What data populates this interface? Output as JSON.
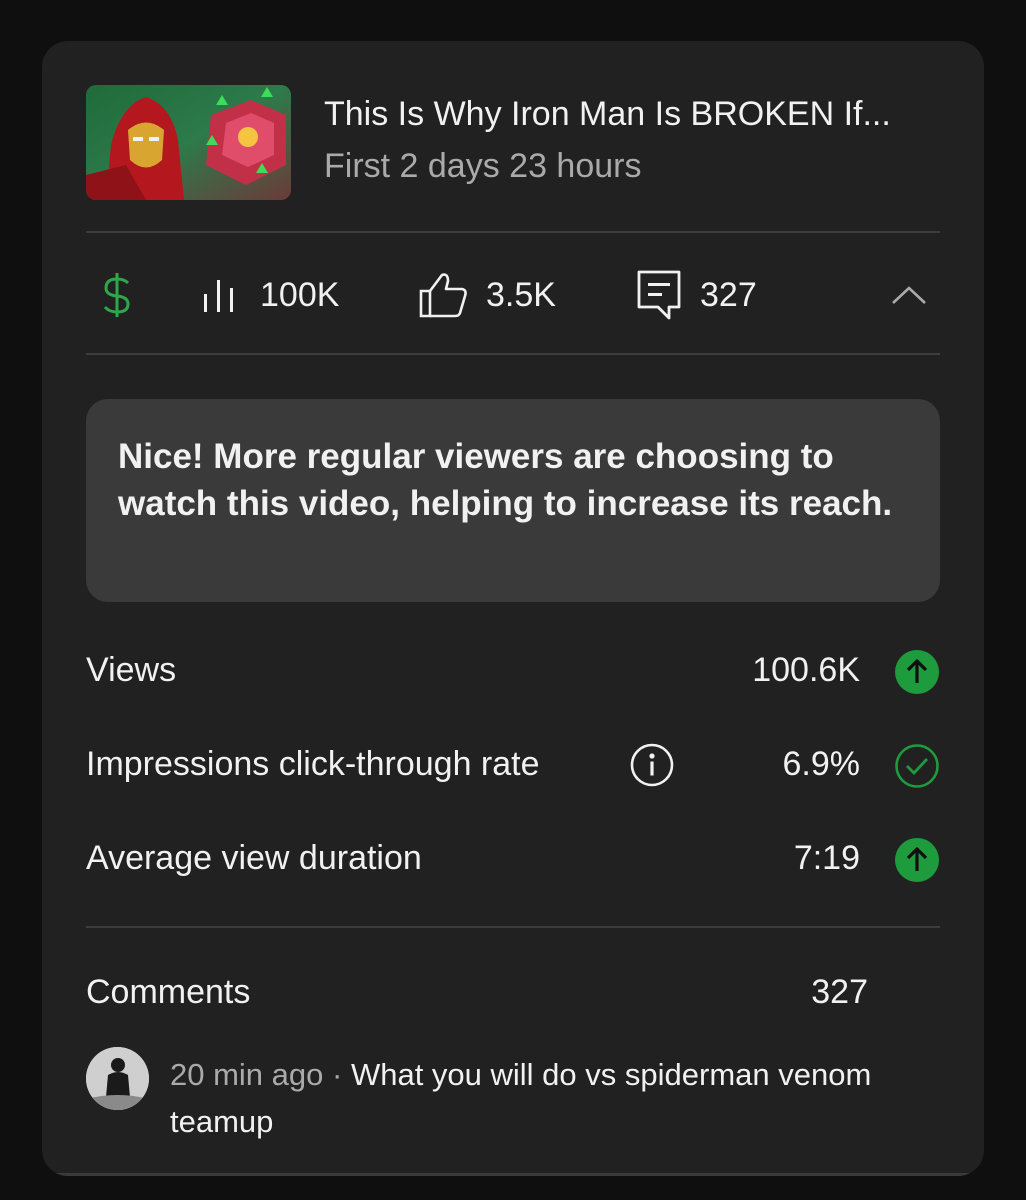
{
  "video": {
    "title": "This Is Why Iron Man Is BROKEN If...",
    "period": "First 2 days 23 hours",
    "thumbnail": "iron-man-thumbnail"
  },
  "stats": {
    "monetization_icon": "dollar-icon",
    "views": "100K",
    "likes": "3.5K",
    "comments": "327",
    "collapse_icon": "chevron-up-icon"
  },
  "message": {
    "text": "Nice! More regular viewers are choosing to watch this video, helping to increase its reach."
  },
  "metrics": [
    {
      "label": "Views",
      "value": "100.6K",
      "status": "arrow-up",
      "status_color": "#1e9b3c"
    },
    {
      "label": "Impressions click-through rate",
      "value": "6.9%",
      "status": "check",
      "status_color": "#1e9b3c"
    },
    {
      "label": "Average view duration",
      "value": "7:19",
      "status": "arrow-up",
      "status_color": "#1e9b3c"
    }
  ],
  "comments_section": {
    "label": "Comments",
    "count": "327",
    "items": [
      {
        "time": "20 min ago",
        "separator": " · ",
        "text": "What you will do vs spiderman venom teamup"
      }
    ]
  },
  "colors": {
    "background": "#0f0f0f",
    "card": "#212121",
    "message_bg": "#3a3a3a",
    "accent_green": "#1e9b3c",
    "text_secondary": "#aaaaaa"
  }
}
